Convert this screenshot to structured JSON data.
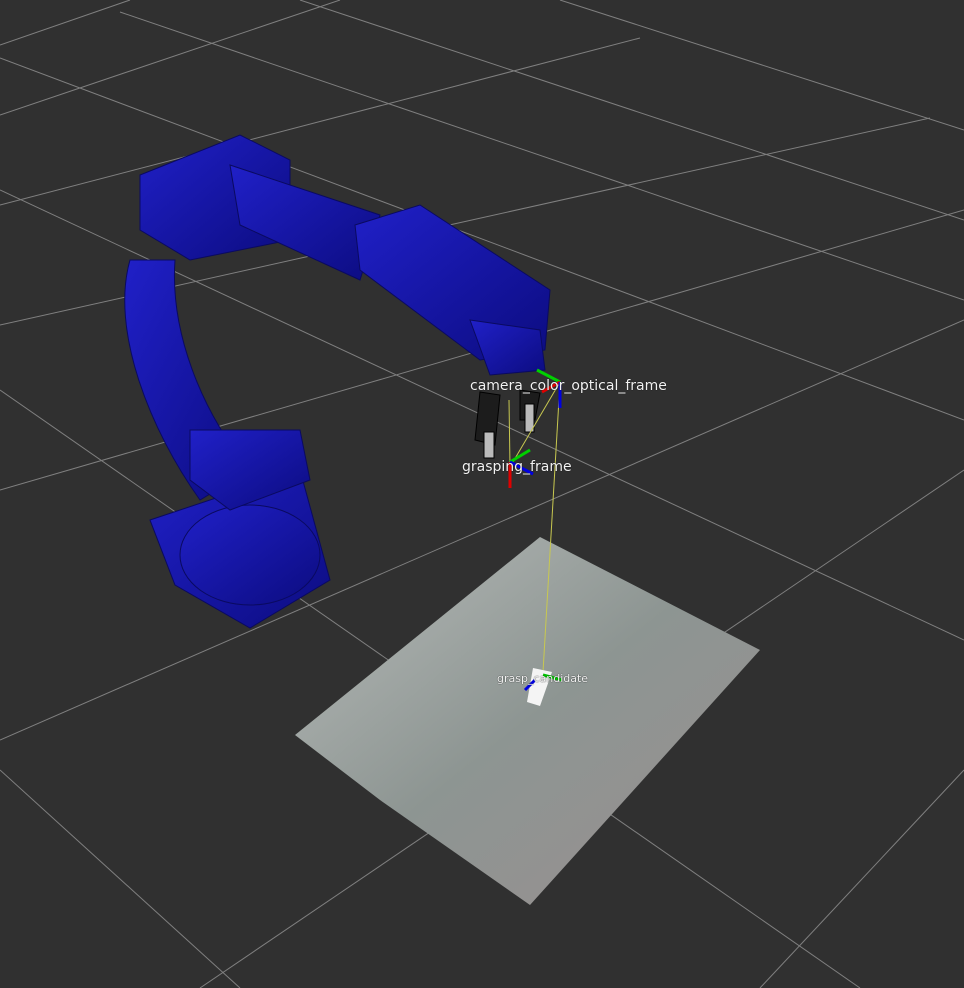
{
  "view": {
    "background_color": "#303030",
    "grid_color": "#a0a0a0",
    "robot_color": "#1414a0",
    "frame_labels": {
      "camera": "camera_color_optical_frame",
      "grasping": "grasping_frame",
      "candidate": "grasp_candidate"
    },
    "axis_colors": {
      "x": "#e00000",
      "y": "#00d000",
      "z": "#0000e0"
    },
    "tf_link_color": "#c8c850"
  }
}
